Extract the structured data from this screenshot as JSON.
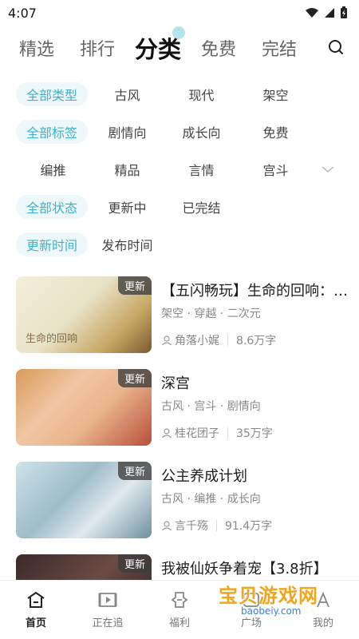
{
  "status": {
    "time": "4:07"
  },
  "top_tabs": [
    "精选",
    "排行",
    "分类",
    "免费",
    "完结"
  ],
  "active_tab": "分类",
  "filters": {
    "type": {
      "all": "全部类型",
      "options": [
        "古风",
        "现代",
        "架空"
      ]
    },
    "tag": {
      "all": "全部标签",
      "options_row1": [
        "剧情向",
        "成长向",
        "免费"
      ],
      "options_row2": [
        "编推",
        "精品",
        "言情",
        "宫斗"
      ]
    },
    "status": {
      "all": "全部状态",
      "options": [
        "更新中",
        "已完结"
      ]
    },
    "sort": {
      "active": "更新时间",
      "options": [
        "发布时间"
      ]
    }
  },
  "books": [
    {
      "badge": "更新",
      "title": "【五闪畅玩】生命的回响：…",
      "tags": "架空 · 穿越 · 二次元",
      "author": "角落小娓",
      "count": "8.6万字",
      "cover_text": "生命的回响"
    },
    {
      "badge": "更新",
      "title": "深宫",
      "tags": "古风 · 宫斗 · 剧情向",
      "author": "桂花团子",
      "count": "35万字",
      "cover_text": ""
    },
    {
      "badge": "更新",
      "title": "公主养成计划",
      "tags": "古风 · 编推 · 成长向",
      "author": "言千殇",
      "count": "91.4万字",
      "cover_text": ""
    },
    {
      "badge": "更新",
      "title": "我被仙妖争着宠【3.8折】",
      "tags": "",
      "author": "",
      "count": "",
      "cover_text": ""
    }
  ],
  "bottom_nav": [
    {
      "label": "首页",
      "icon": "home-icon"
    },
    {
      "label": "正在追",
      "icon": "play-icon"
    },
    {
      "label": "福利",
      "icon": "gift-icon"
    },
    {
      "label": "广场",
      "icon": "square-icon"
    },
    {
      "label": "我的",
      "icon": "profile-icon"
    }
  ],
  "watermark": {
    "text": "宝贝游戏网",
    "url": "baobeiy.com"
  },
  "colors": {
    "accent": "#3fb3c8",
    "chip_bg": "#eef7f9"
  }
}
